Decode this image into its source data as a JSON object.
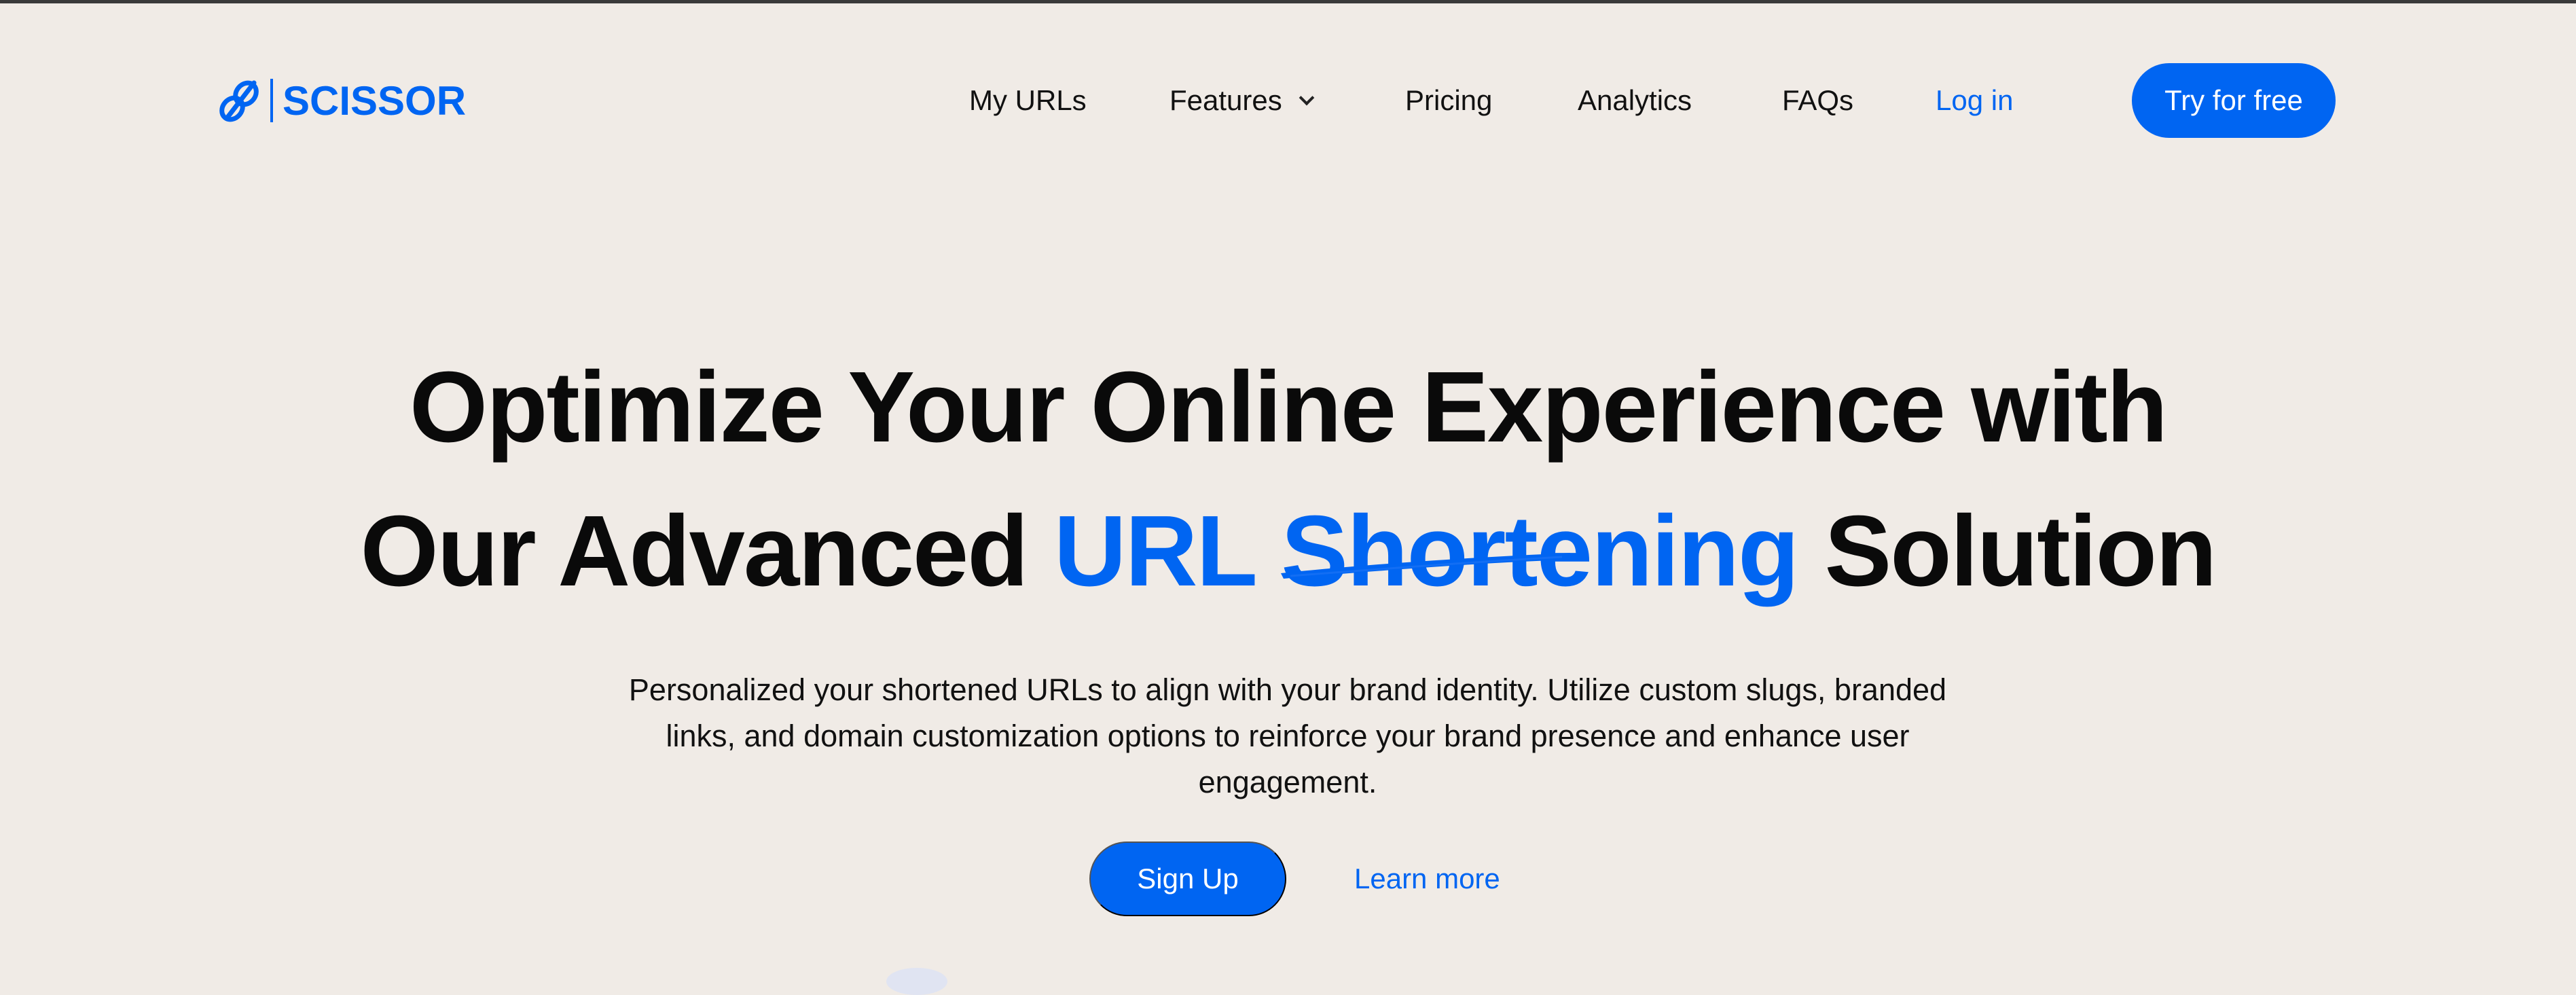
{
  "brand": {
    "name": "SCISSOR",
    "accent_color": "#0065f2",
    "logo_icon": "chain-link-icon"
  },
  "nav": {
    "items": [
      {
        "label": "My URLs"
      },
      {
        "label": "Features",
        "icon": "chevron-down-icon"
      },
      {
        "label": "Pricing"
      },
      {
        "label": "Analytics"
      },
      {
        "label": "FAQs"
      }
    ],
    "login_label": "Log in",
    "cta_label": "Try for free"
  },
  "hero": {
    "title_line1": "Optimize Your Online Experience with",
    "title_line2_prefix": "Our Advanced ",
    "title_highlight": "URL Shortening",
    "title_line2_suffix": " Solution",
    "subtitle": "Personalized your shortened URLs to align with your brand identity. Utilize custom slugs, branded links, and domain customization options to reinforce your brand presence and enhance user engagement.",
    "signup_label": "Sign Up",
    "learn_more_label": "Learn more"
  },
  "colors": {
    "background": "#f0ebe6",
    "text": "#0a0a0a",
    "accent": "#0065f2"
  }
}
